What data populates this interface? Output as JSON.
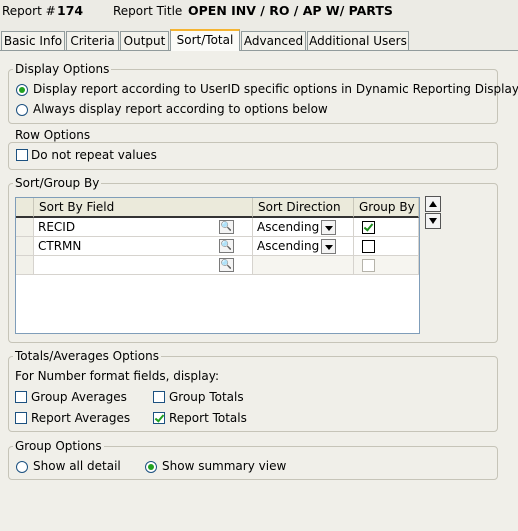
{
  "header": {
    "report_num_label": "Report #",
    "report_num": "174",
    "report_title_label": "Report Title",
    "report_title": "OPEN INV / RO / AP W/ PARTS"
  },
  "tabs": [
    {
      "label": "Basic Info"
    },
    {
      "label": "Criteria"
    },
    {
      "label": "Output"
    },
    {
      "label": "Sort/Total",
      "active": true
    },
    {
      "label": "Advanced"
    },
    {
      "label": "Additional Users"
    }
  ],
  "display_options": {
    "title": "Display Options",
    "option1": "Display report according to UserID specific options in Dynamic Reporting Display",
    "option2": "Always display report according to options below",
    "selected": "option1"
  },
  "row_options": {
    "title": "Row Options",
    "no_repeat": "Do not repeat values",
    "no_repeat_checked": false
  },
  "sort_group": {
    "title": "Sort/Group By",
    "columns": [
      "Sort By Field",
      "Sort Direction",
      "Group By"
    ],
    "rows": [
      {
        "field": "RECID",
        "direction": "Ascending",
        "group_by": true
      },
      {
        "field": "CTRMN",
        "direction": "Ascending",
        "group_by": false
      },
      {
        "field": "",
        "direction": "",
        "group_by": false
      }
    ]
  },
  "totals": {
    "title": "Totals/Averages Options",
    "subtitle": "For Number format fields, display:",
    "group_averages": "Group Averages",
    "group_averages_checked": false,
    "group_totals": "Group Totals",
    "group_totals_checked": false,
    "report_averages": "Report Averages",
    "report_averages_checked": false,
    "report_totals": "Report Totals",
    "report_totals_checked": true
  },
  "group_options": {
    "title": "Group Options",
    "all_detail": "Show all detail",
    "summary": "Show summary view",
    "selected": "summary"
  },
  "icons": {
    "lookup": "magnifier-icon",
    "move_up": "arrow-up-icon",
    "move_down": "arrow-down-icon"
  }
}
